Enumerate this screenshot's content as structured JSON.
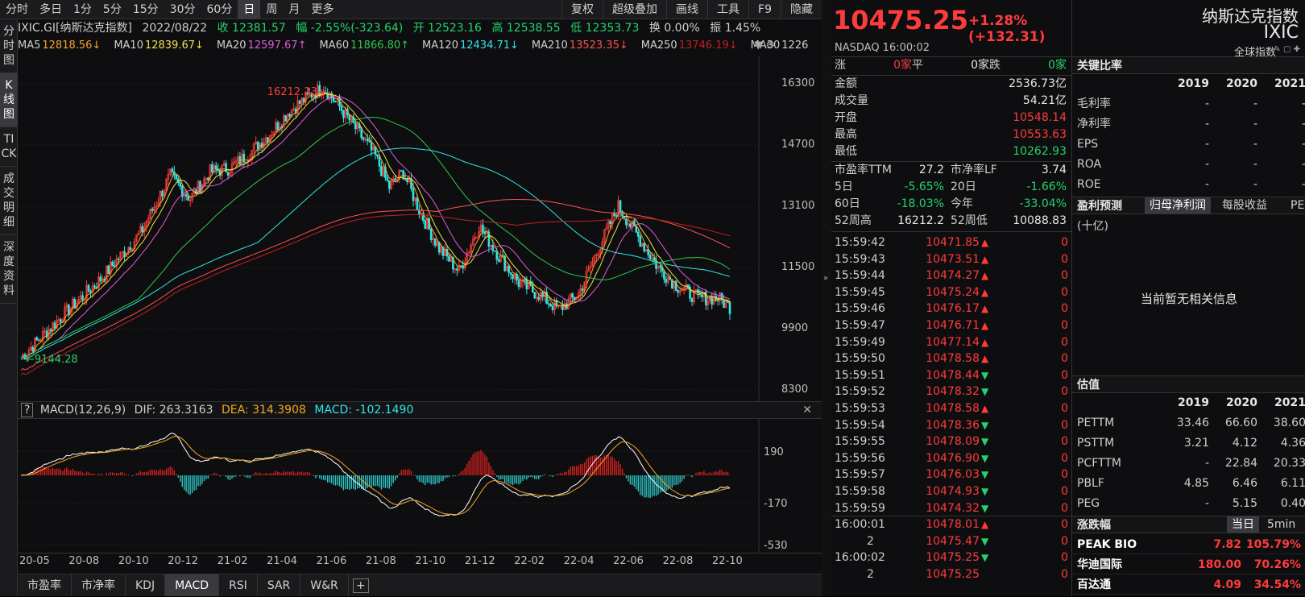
{
  "toolbar": {
    "items": [
      "分时",
      "多日",
      "1分",
      "5分",
      "15分",
      "30分",
      "60分",
      "日",
      "周",
      "月",
      "更多"
    ],
    "active": "日",
    "right": [
      "复权",
      "超级叠加",
      "画线",
      "工具",
      "F9",
      "隐藏"
    ]
  },
  "sidenav": [
    {
      "label": "分时图"
    },
    {
      "label": "K线图",
      "active": true
    },
    {
      "label": "TICK"
    },
    {
      "label": "成交明细"
    },
    {
      "label": "深度资料"
    }
  ],
  "infoline": {
    "code": "IXIC.GI[纳斯达克指数]",
    "date": "2022/08/22",
    "close": "收 12381.57",
    "amp": "幅 -2.55%(-323.64)",
    "open": "开 12523.16",
    "high": "高 12538.55",
    "low": "低 12353.73",
    "turnover": "换 0.00%",
    "swing": "振 1.45%"
  },
  "ma": [
    {
      "label": "MA5",
      "value": "12818.56↓",
      "color": "#f4a623"
    },
    {
      "label": "MA10",
      "value": "12839.67↓",
      "color": "#f4e04d"
    },
    {
      "label": "MA20",
      "value": "12597.67↑",
      "color": "#e05bd8"
    },
    {
      "label": "MA60",
      "value": "11866.80↑",
      "color": "#30c84a"
    },
    {
      "label": "MA120",
      "value": "12434.71↓",
      "color": "#2ee6e6"
    },
    {
      "label": "MA210",
      "value": "13523.35↓",
      "color": "#ff5050"
    },
    {
      "label": "MA250",
      "value": "13746.19↓",
      "color": "#c02020"
    },
    {
      "label": "MA30",
      "value": "1226",
      "color": "#cfcfcf"
    }
  ],
  "kaxis": {
    "labels": [
      "16300",
      "14700",
      "13100",
      "11500",
      "9900",
      "8300"
    ],
    "max_label": "16212.23",
    "min_label": "9144.28"
  },
  "macd": {
    "title": "MACD(12,26,9)",
    "dif": "DIF: 263.3163",
    "dea": "DEA: 314.3908",
    "macd": "MACD: -102.1490",
    "axis": [
      "190",
      "-170",
      "-530"
    ]
  },
  "xaxis": [
    "20-05",
    "20-08",
    "20-10",
    "20-12",
    "21-02",
    "21-04",
    "21-06",
    "21-08",
    "21-10",
    "21-12",
    "22-02",
    "22-04",
    "22-06",
    "22-08",
    "22-10"
  ],
  "bottomtabs": [
    "市盈率",
    "市净率",
    "KDJ",
    "MACD",
    "RSI",
    "SAR",
    "W&R"
  ],
  "bottom_active": "MACD",
  "quote": {
    "price": "10475.25",
    "change": "+1.28% (+132.31)",
    "exch": "NASDAQ  16:00:02",
    "updown": {
      "up_l": "涨",
      "up_v": "0家",
      "flat_l": "平",
      "flat_v": "0家",
      "down_l": "跌",
      "down_v": "0家"
    },
    "rows": [
      {
        "k": "金额",
        "v": "2536.73亿",
        "c": "#e6e6e6"
      },
      {
        "k": "成交量",
        "v": "54.21亿",
        "c": "#e6e6e6"
      },
      {
        "k": "开盘",
        "v": "10548.14",
        "c": "#ff3b3b"
      },
      {
        "k": "最高",
        "v": "10553.63",
        "c": "#ff3b3b"
      },
      {
        "k": "最低",
        "v": "10262.93",
        "c": "#24d36b"
      }
    ],
    "pairs": [
      {
        "k1": "市盈率TTM",
        "v1": "27.2",
        "c1": "#e6e6e6",
        "k2": "市净率LF",
        "v2": "3.74",
        "c2": "#e6e6e6"
      },
      {
        "k1": "5日",
        "v1": "-5.65%",
        "c1": "#24d36b",
        "k2": "20日",
        "v2": "-1.66%",
        "c2": "#24d36b"
      },
      {
        "k1": "60日",
        "v1": "-18.03%",
        "c1": "#24d36b",
        "k2": "今年",
        "v2": "-33.04%",
        "c2": "#24d36b"
      },
      {
        "k1": "52周高",
        "v1": "16212.2",
        "c1": "#e6e6e6",
        "k2": "52周低",
        "v2": "10088.83",
        "c2": "#e6e6e6"
      }
    ],
    "ticks": [
      {
        "t": "15:59:42",
        "p": "10471.85",
        "a": "up",
        "v": "0"
      },
      {
        "t": "15:59:43",
        "p": "10473.51",
        "a": "up",
        "v": "0"
      },
      {
        "t": "15:59:44",
        "p": "10474.27",
        "a": "up",
        "v": "0"
      },
      {
        "t": "15:59:45",
        "p": "10475.24",
        "a": "up",
        "v": "0"
      },
      {
        "t": "15:59:46",
        "p": "10476.17",
        "a": "up",
        "v": "0"
      },
      {
        "t": "15:59:47",
        "p": "10476.71",
        "a": "up",
        "v": "0"
      },
      {
        "t": "15:59:49",
        "p": "10477.14",
        "a": "up",
        "v": "0"
      },
      {
        "t": "15:59:50",
        "p": "10478.58",
        "a": "up",
        "v": "0"
      },
      {
        "t": "15:59:51",
        "p": "10478.44",
        "a": "down",
        "v": "0"
      },
      {
        "t": "15:59:52",
        "p": "10478.32",
        "a": "down",
        "v": "0"
      },
      {
        "t": "15:59:53",
        "p": "10478.58",
        "a": "up",
        "v": "0"
      },
      {
        "t": "15:59:54",
        "p": "10478.36",
        "a": "down",
        "v": "0"
      },
      {
        "t": "15:59:55",
        "p": "10478.09",
        "a": "down",
        "v": "0"
      },
      {
        "t": "15:59:56",
        "p": "10476.90",
        "a": "down",
        "v": "0"
      },
      {
        "t": "15:59:57",
        "p": "10476.03",
        "a": "down",
        "v": "0"
      },
      {
        "t": "15:59:58",
        "p": "10474.93",
        "a": "down",
        "v": "0"
      },
      {
        "t": "15:59:59",
        "p": "10474.32",
        "a": "down",
        "v": "0"
      },
      {
        "t": "16:00:01",
        "p": "10478.01",
        "a": "up",
        "v": "0"
      },
      {
        "t": "2",
        "p": "10475.47",
        "a": "down",
        "v": "0"
      },
      {
        "t": "16:00:02",
        "p": "10475.25",
        "a": "down",
        "v": "0"
      },
      {
        "t": "2",
        "p": "10475.25",
        "a": "",
        "v": "0"
      }
    ]
  },
  "panel": {
    "name": "纳斯达克指数",
    "code": "IXIC",
    "category": "全球指数",
    "ratio_title": "关键比率",
    "years": [
      "2019",
      "2020",
      "2021"
    ],
    "ratios": [
      {
        "k": "毛利率",
        "v": [
          "-",
          "-",
          "-"
        ]
      },
      {
        "k": "净利率",
        "v": [
          "-",
          "-",
          "-"
        ]
      },
      {
        "k": "EPS",
        "v": [
          "-",
          "-",
          "-"
        ]
      },
      {
        "k": "ROA",
        "v": [
          "-",
          "-",
          "-"
        ]
      },
      {
        "k": "ROE",
        "v": [
          "-",
          "-",
          "-"
        ]
      }
    ],
    "profit_title": "盈利预测",
    "profit_tabs": [
      "归母净利润",
      "每股收益",
      "PE"
    ],
    "unit": "(十亿)",
    "nodata": "当前暂无相关信息",
    "val_title": "估值",
    "vals": [
      {
        "k": "PETTM",
        "v": [
          "33.46",
          "66.60",
          "38.60"
        ]
      },
      {
        "k": "PSTTM",
        "v": [
          "3.21",
          "4.12",
          "4.36"
        ]
      },
      {
        "k": "PCFTTM",
        "v": [
          "-",
          "22.84",
          "20.33"
        ]
      },
      {
        "k": "PBLF",
        "v": [
          "4.85",
          "6.46",
          "6.11"
        ]
      },
      {
        "k": "PEG",
        "v": [
          "-",
          "5.15",
          "0.40"
        ]
      }
    ],
    "zdf_title": "涨跌幅",
    "zdf_tabs": [
      "当日",
      "5min"
    ],
    "movers": [
      {
        "n": "PEAK BIO",
        "p": "7.82",
        "c": "105.79%"
      },
      {
        "n": "华迪国际",
        "p": "180.00",
        "c": "70.26%"
      },
      {
        "n": "百达通",
        "p": "4.09",
        "c": "34.54%"
      }
    ]
  }
}
